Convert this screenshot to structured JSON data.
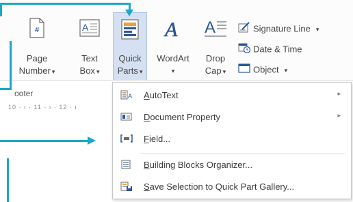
{
  "ribbon": {
    "page_number": {
      "line1": "Page",
      "line2": "Number",
      "caret": "▾",
      "icon": "page-number-icon"
    },
    "text_box": {
      "line1": "Text",
      "line2": "Box",
      "caret": "▾",
      "icon": "text-box-icon"
    },
    "quick_parts": {
      "line1": "Quick",
      "line2": "Parts",
      "caret": "▾",
      "icon": "quick-parts-icon"
    },
    "wordart": {
      "line1": "WordArt",
      "caret": "▾",
      "icon": "wordart-icon"
    },
    "drop_cap": {
      "line1": "Drop",
      "line2": "Cap",
      "caret": "▾",
      "icon": "drop-cap-icon"
    },
    "signature_line": {
      "label": "Signature Line",
      "caret": "▾",
      "icon": "signature-line-icon"
    },
    "date_time": {
      "label": "Date & Time",
      "icon": "date-time-icon"
    },
    "object": {
      "label": "Object",
      "caret": "▾",
      "icon": "object-icon"
    },
    "group_label_footer": "ooter"
  },
  "ruler": {
    "text": "10 · ı · 11 · ı · 12 · ı"
  },
  "menu": {
    "items": [
      {
        "label": "AutoText",
        "accel": "A",
        "rest": "utoText",
        "submenu": true,
        "icon": "autotext-icon"
      },
      {
        "label": "Document Property",
        "accel": "D",
        "rest": "ocument Property",
        "submenu": true,
        "icon": "document-property-icon"
      },
      {
        "label": "Field...",
        "accel": "F",
        "rest": "ield...",
        "submenu": false,
        "icon": "field-icon"
      },
      {
        "label": "Building Blocks Organizer...",
        "accel": "B",
        "rest": "uilding Blocks Organizer...",
        "submenu": false,
        "icon": "building-blocks-icon"
      },
      {
        "label": "Save Selection to Quick Part Gallery...",
        "accel": "S",
        "rest": "ave Selection to Quick Part Gallery...",
        "submenu": false,
        "icon": "save-selection-icon"
      }
    ],
    "submenu_arrow": "▸"
  },
  "colors": {
    "callout": "#1aa7c9",
    "highlight": "#d5e1f2",
    "icon_blue": "#2b579a"
  }
}
